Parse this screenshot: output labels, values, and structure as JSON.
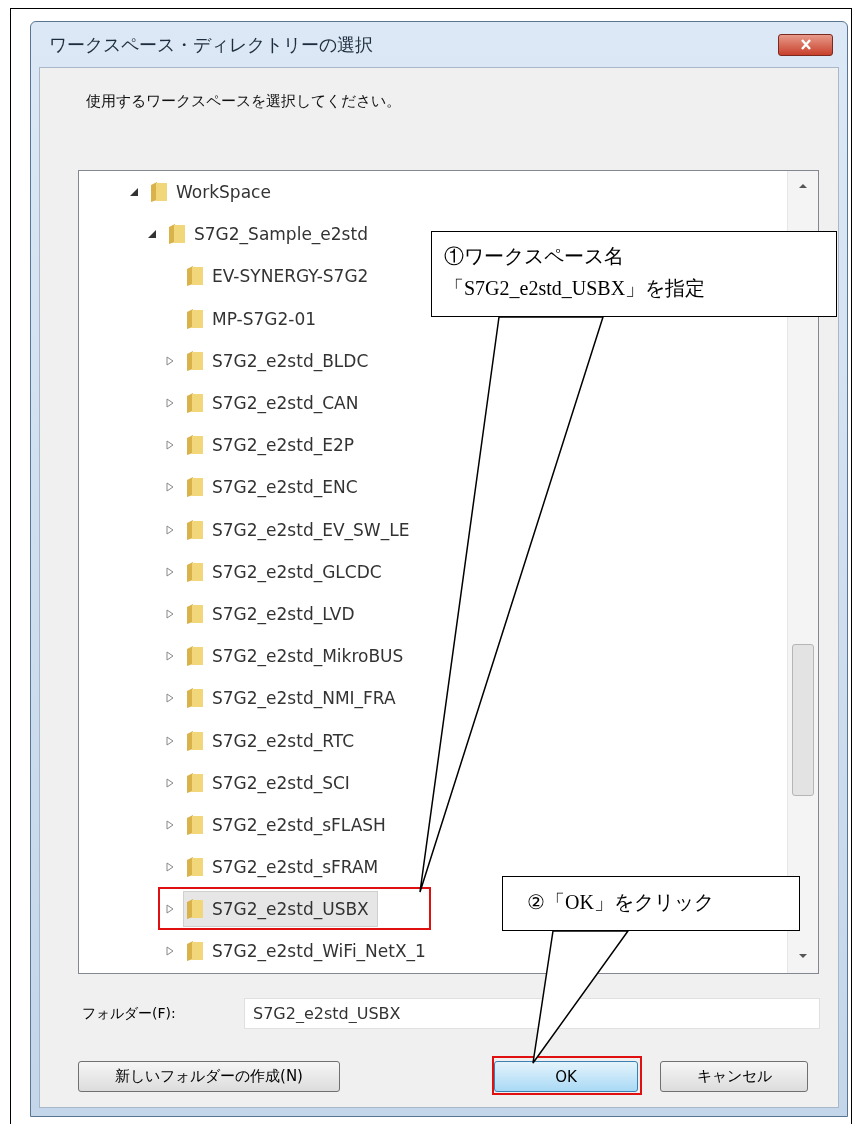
{
  "window": {
    "title": "ワークスペース・ディレクトリーの選択"
  },
  "instruction": "使用するワークスペースを選択してください。",
  "tree": [
    {
      "label": "WorkSpace",
      "expanded": true,
      "selected": false,
      "children": [
        {
          "label": "S7G2_Sample_e2std",
          "expanded": true,
          "selected": false,
          "children": [
            {
              "label": "EV-SYNERGY-S7G2",
              "selected": false
            },
            {
              "label": "MP-S7G2-01",
              "selected": false
            },
            {
              "label": "S7G2_e2std_BLDC",
              "expanded": false,
              "selected": false
            },
            {
              "label": "S7G2_e2std_CAN",
              "expanded": false,
              "selected": false
            },
            {
              "label": "S7G2_e2std_E2P",
              "expanded": false,
              "selected": false
            },
            {
              "label": "S7G2_e2std_ENC",
              "expanded": false,
              "selected": false
            },
            {
              "label": "S7G2_e2std_EV_SW_LE",
              "expanded": false,
              "selected": false
            },
            {
              "label": "S7G2_e2std_GLCDC",
              "expanded": false,
              "selected": false
            },
            {
              "label": "S7G2_e2std_LVD",
              "expanded": false,
              "selected": false
            },
            {
              "label": "S7G2_e2std_MikroBUS",
              "expanded": false,
              "selected": false
            },
            {
              "label": "S7G2_e2std_NMI_FRA",
              "expanded": false,
              "selected": false
            },
            {
              "label": "S7G2_e2std_RTC",
              "expanded": false,
              "selected": false
            },
            {
              "label": "S7G2_e2std_SCI",
              "expanded": false,
              "selected": false
            },
            {
              "label": "S7G2_e2std_sFLASH",
              "expanded": false,
              "selected": false
            },
            {
              "label": "S7G2_e2std_sFRAM",
              "expanded": false,
              "selected": false
            },
            {
              "label": "S7G2_e2std_USBX",
              "expanded": false,
              "selected": true
            },
            {
              "label": "S7G2_e2std_WiFi_NetX_1",
              "expanded": false,
              "selected": false
            }
          ]
        }
      ]
    }
  ],
  "folder": {
    "label": "フォルダー(F):",
    "value": "S7G2_e2std_USBX"
  },
  "buttons": [
    {
      "label": "新しいフォルダーの作成(N)",
      "kind": "new"
    },
    {
      "label": "OK",
      "kind": "ok"
    },
    {
      "label": "キャンセル",
      "kind": "cancel"
    }
  ],
  "callouts": [
    {
      "lines": [
        "①ワークスペース名",
        "「S7G2_e2std_USBX」を指定"
      ],
      "kind": "tree"
    },
    {
      "lines": [
        "②「OK」をクリック"
      ],
      "kind": "ok"
    }
  ]
}
